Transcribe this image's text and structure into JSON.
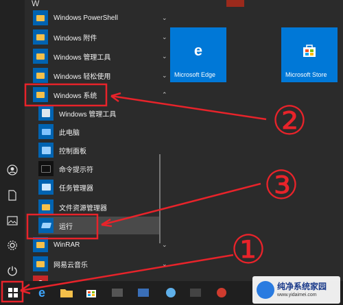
{
  "start_menu": {
    "section_letter": "W",
    "items": [
      {
        "label": "Windows PowerShell",
        "chevron": "⌄"
      },
      {
        "label": "Windows 附件",
        "chevron": "⌄"
      },
      {
        "label": "Windows 管理工具",
        "chevron": "⌄"
      },
      {
        "label": "Windows 轻松使用",
        "chevron": "⌄"
      },
      {
        "label": "Windows 系统",
        "chevron": "⌃"
      }
    ],
    "sub_items": [
      {
        "label": "Windows 管理工具"
      },
      {
        "label": "此电脑"
      },
      {
        "label": "控制面板"
      },
      {
        "label": "命令提示符"
      },
      {
        "label": "任务管理器"
      },
      {
        "label": "文件资源管理器"
      },
      {
        "label": "运行"
      }
    ],
    "more_items": [
      {
        "label": "WinRAR",
        "chevron": "⌄"
      },
      {
        "label": "网易云音乐",
        "chevron": "⌄"
      }
    ]
  },
  "tiles": [
    {
      "label": "Microsoft Edge"
    },
    {
      "label": "Microsoft Store"
    }
  ],
  "annotations": {
    "n1": "①",
    "n2": "②",
    "n3": "③"
  },
  "watermark": {
    "name": "纯净系统家园",
    "url": "www.yidaimei.com"
  }
}
